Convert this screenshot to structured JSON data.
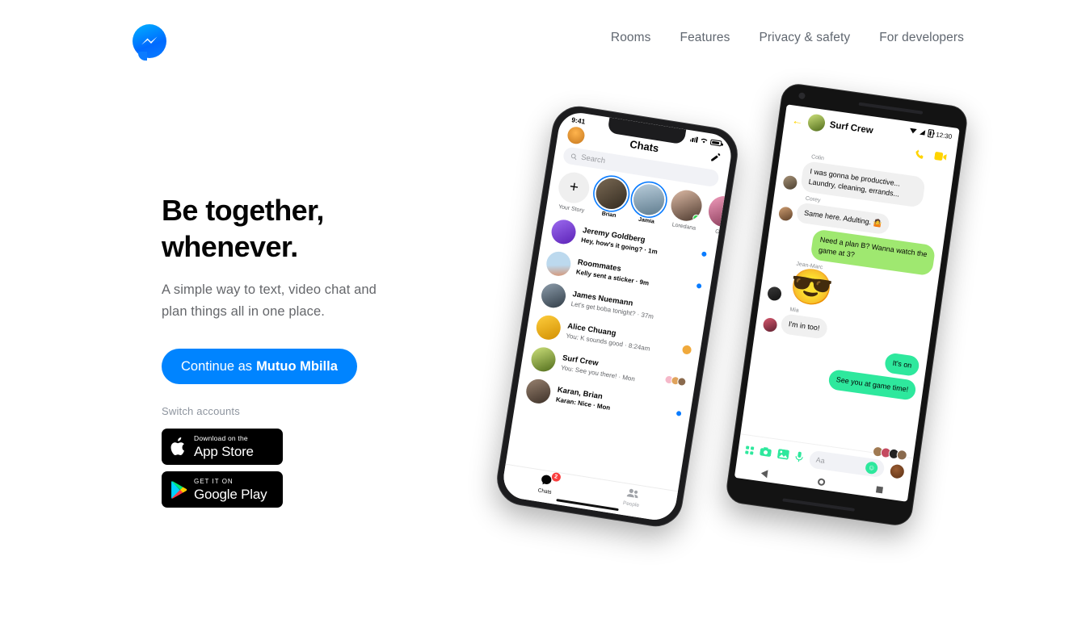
{
  "brand": {
    "logo_icon": "messenger-logo",
    "accent_blue": "#0084ff"
  },
  "nav": {
    "items": [
      {
        "label": "Rooms"
      },
      {
        "label": "Features"
      },
      {
        "label": "Privacy & safety"
      },
      {
        "label": "For developers"
      }
    ]
  },
  "hero": {
    "headline_line1": "Be together,",
    "headline_line2": "whenever.",
    "subhead": "A simple way to text, video chat and plan things all in one place.",
    "cta_prefix": "Continue as",
    "cta_name": "Mutuo Mbilla",
    "switch_accounts": "Switch accounts",
    "badges": [
      {
        "small": "Download on the",
        "big": "App Store",
        "icon": "apple-icon"
      },
      {
        "small": "GET IT ON",
        "big": "Google Play",
        "icon": "google-play-icon"
      }
    ]
  },
  "iphone": {
    "status": {
      "time": "9:41"
    },
    "title": "Chats",
    "search_placeholder": "Search",
    "stories": [
      {
        "name": "Your Story",
        "type": "add"
      },
      {
        "name": "Brian",
        "ring": true,
        "color1": "#6b5b4a",
        "color2": "#3d3228"
      },
      {
        "name": "Jamia",
        "ring": true,
        "color1": "#9fb3c8",
        "color2": "#5d7a8c"
      },
      {
        "name": "Loredana",
        "online": true,
        "color1": "#c9a18a",
        "color2": "#5a4236"
      },
      {
        "name": "Gord",
        "color1": "#f08ab0",
        "color2": "#8c3f5c"
      }
    ],
    "chats": [
      {
        "name": "Jeremy Goldberg",
        "snippet": "Hey, how's it going? · 1m",
        "unread": true,
        "dot": true,
        "color1": "#8b5cf6",
        "color2": "#5b21b6"
      },
      {
        "name": "Roommates",
        "snippet": "Kelly sent a sticker · 9m",
        "unread": true,
        "dot": true,
        "color1": "#a8c8e8",
        "color2": "#d88f6a"
      },
      {
        "name": "James Nuemann",
        "snippet": "Let's get boba tonight? · 37m",
        "unread": false,
        "color1": "#6e7f8d",
        "color2": "#2f3b45"
      },
      {
        "name": "Alice Chuang",
        "snippet": "You: K sounds good · 8:24am",
        "unread": false,
        "seen": "single",
        "color1": "#ffc107",
        "color2": "#c98a00"
      },
      {
        "name": "Surf Crew",
        "snippet": "You: See you there! · Mon",
        "unread": false,
        "seen": "group",
        "color1": "#bcd96a",
        "color2": "#5c7a1e"
      },
      {
        "name": "Karan, Brian",
        "snippet": "Karan: Nice · Mon",
        "unread": true,
        "dot": true,
        "color1": "#7a6455",
        "color2": "#3b2f26"
      }
    ],
    "tabs": [
      {
        "label": "Chats",
        "icon": "chat-bubble-icon",
        "badge": "2",
        "active": true
      },
      {
        "label": "People",
        "icon": "people-icon",
        "active": false
      }
    ]
  },
  "android": {
    "status": {
      "time": "12:30"
    },
    "title": "Surf Crew",
    "back_icon": "back-arrow-icon",
    "call_icon": "phone-icon",
    "video_icon": "video-camera-icon",
    "messages": [
      {
        "sender": "Colin",
        "text": "I was gonna be productive... Laundry, cleaning, errands...",
        "side": "in",
        "avatar1": "#8a7a62",
        "avatar2": "#4a3f30"
      },
      {
        "sender": "Corey",
        "text": "Same here. Adulting. 🤷",
        "side": "in",
        "avatar1": "#b58a63",
        "avatar2": "#5c3f28"
      },
      {
        "sender": "",
        "text": "Need a plan B? Wanna watch the game at 3?",
        "side": "out"
      },
      {
        "sender": "Jean-Marc",
        "text": "😎",
        "side": "emoji",
        "avatar1": "#2b2b2b",
        "avatar2": "#111111"
      },
      {
        "sender": "Mia",
        "text": "I'm in too!",
        "side": "in",
        "avatar1": "#c4495f",
        "avatar2": "#5e2030"
      },
      {
        "sender": "",
        "text": "It's on",
        "side": "out2"
      },
      {
        "sender": "",
        "text": "See you at game time!",
        "side": "out2"
      }
    ],
    "composer": {
      "placeholder": "Aa",
      "icons": [
        "apps-grid-icon",
        "camera-icon",
        "gallery-icon",
        "microphone-icon"
      ],
      "emoji_icon": "smiley-icon",
      "sticker_icon": "football-icon"
    },
    "navbar": [
      "back-triangle-icon",
      "home-circle-icon",
      "recents-square-icon"
    ]
  }
}
